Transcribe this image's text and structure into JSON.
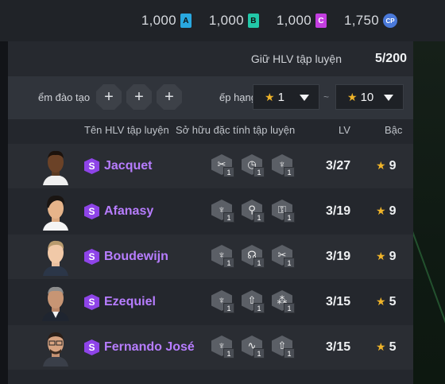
{
  "currencies": [
    {
      "value": "1,000",
      "icon": "A",
      "color": "#29a8e0"
    },
    {
      "value": "1,000",
      "icon": "B",
      "color": "#22c7a8"
    },
    {
      "value": "1,000",
      "icon": "C",
      "color": "#c33ee0"
    },
    {
      "value": "1,750",
      "icon": "CP",
      "color": "#4a79d9"
    }
  ],
  "slots": {
    "label": "Giữ HLV tập luyện",
    "count": "5/200"
  },
  "filters": {
    "label_left": "ểm đào tạo",
    "plus_buttons": [
      "+",
      "+",
      "+"
    ],
    "label_right": "ếp hạng",
    "min": "1",
    "max": "10",
    "separator": "~"
  },
  "columns": {
    "name": "Tên HLV tập luyện",
    "traits": "Sở hữu đặc tính tập luyện",
    "lv": "LV",
    "grade": "Bậc"
  },
  "accent": {
    "rarity": "#8e44e8",
    "name": "#b77dff",
    "star": "#f0b429"
  },
  "coaches": [
    {
      "name": "Jacquet",
      "rarity": "S",
      "lv": "3/27",
      "grade": "9",
      "traits": [
        {
          "icon": "scissors-icon",
          "level": "1"
        },
        {
          "icon": "clock-icon",
          "level": "1"
        },
        {
          "icon": "trophy-icon",
          "level": "1"
        }
      ]
    },
    {
      "name": "Afanasy",
      "rarity": "S",
      "lv": "3/19",
      "grade": "9",
      "traits": [
        {
          "icon": "trophy-icon",
          "level": "1"
        },
        {
          "icon": "tie-icon",
          "level": "1"
        },
        {
          "icon": "lock-icon",
          "level": "1"
        }
      ]
    },
    {
      "name": "Boudewijn",
      "rarity": "S",
      "lv": "3/19",
      "grade": "9",
      "traits": [
        {
          "icon": "trophy-icon",
          "level": "1"
        },
        {
          "icon": "whistle-icon",
          "level": "1"
        },
        {
          "icon": "scissors-icon",
          "level": "1"
        }
      ]
    },
    {
      "name": "Ezequiel",
      "rarity": "S",
      "lv": "3/15",
      "grade": "5",
      "traits": [
        {
          "icon": "trophy-icon",
          "level": "1"
        },
        {
          "icon": "arrow-up-icon",
          "level": "1"
        },
        {
          "icon": "grapes-icon",
          "level": "1"
        }
      ]
    },
    {
      "name": "Fernando José",
      "rarity": "S",
      "lv": "3/15",
      "grade": "5",
      "traits": [
        {
          "icon": "trophy-icon",
          "level": "1"
        },
        {
          "icon": "wave-icon",
          "level": "1"
        },
        {
          "icon": "arrow-up-icon",
          "level": "1"
        }
      ]
    }
  ]
}
